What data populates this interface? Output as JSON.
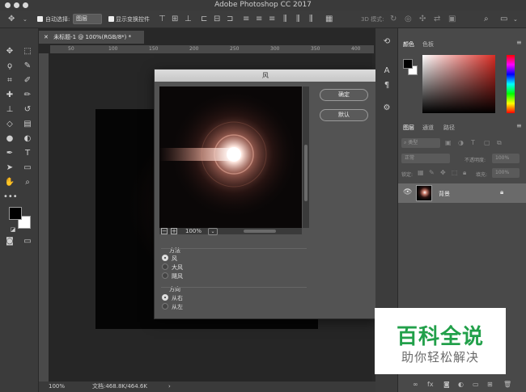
{
  "window": {
    "title": "Adobe Photoshop CC 2017"
  },
  "options_bar": {
    "auto_select_label": "自动选择:",
    "auto_select_value": "图层",
    "show_transform_label": "显示变换控件",
    "mode_3d_label": "3D 模式:"
  },
  "document": {
    "tab_label": "未标题-1 @ 100%(RGB/8*) *",
    "ruler_marks": [
      "50",
      "100",
      "150",
      "200",
      "250",
      "300",
      "350",
      "400"
    ],
    "zoom": "100%",
    "doc_size": "文档:468.8K/464.6K"
  },
  "dialog": {
    "title": "风",
    "ok_label": "确定",
    "default_label": "默认",
    "preview_zoom": "100%",
    "method_label": "方法",
    "method_options": [
      "风",
      "大风",
      "飓风"
    ],
    "method_selected": "风",
    "direction_label": "方向",
    "direction_options": [
      "从右",
      "从左"
    ],
    "direction_selected": "从右"
  },
  "color_panel": {
    "tabs": [
      "颜色",
      "色板"
    ]
  },
  "layers_panel": {
    "tabs": [
      "图层",
      "通道",
      "路径"
    ],
    "filter_label": "类型",
    "blend_mode": "正常",
    "opacity_label": "不透明度:",
    "opacity_value": "100%",
    "lock_label": "锁定:",
    "fill_label": "填充:",
    "fill_value": "100%",
    "layers": [
      {
        "name": "背景"
      }
    ]
  },
  "watermark": {
    "title": "百科全说",
    "subtitle": "助你轻松解决"
  },
  "colors": {
    "accent_green": "#22a04a",
    "flare_core": "#ffffff",
    "flare_glow": "#c97a6a"
  }
}
